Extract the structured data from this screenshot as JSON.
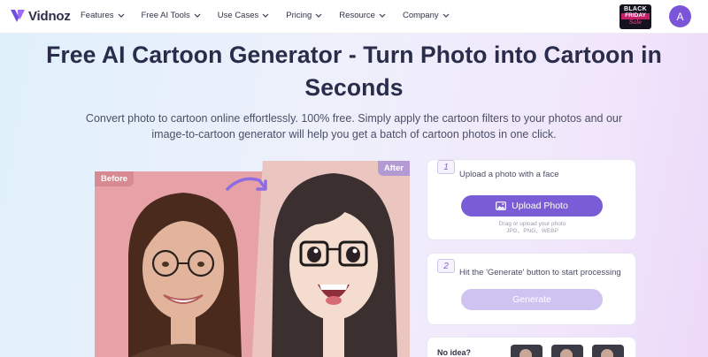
{
  "brand": {
    "name": "Vidnoz"
  },
  "nav": {
    "items": [
      {
        "label": "Features"
      },
      {
        "label": "Free AI Tools"
      },
      {
        "label": "Use Cases"
      },
      {
        "label": "Pricing"
      },
      {
        "label": "Resource"
      },
      {
        "label": "Company"
      }
    ],
    "promo": {
      "line1": "BLACK",
      "line2": "FRIDAY",
      "line3": "Sale"
    },
    "avatar_initial": "A"
  },
  "hero": {
    "title": "Free AI Cartoon Generator - Turn Photo into Cartoon in Seconds",
    "subtitle": "Convert photo to cartoon online effortlessly. 100% free. Simply apply the cartoon filters to your photos and our image-to-cartoon generator will help you get a batch of cartoon photos in one click."
  },
  "preview": {
    "before_label": "Before",
    "after_label": "After"
  },
  "steps": {
    "step1": {
      "number": "1",
      "text": "Upload a photo with a face",
      "button": "Upload Photo",
      "hint_line1": "Drag or upload your photo",
      "hint_line2": "JPG、PNG、WEBP"
    },
    "step2": {
      "number": "2",
      "text": "Hit the 'Generate' button to start processing",
      "button": "Generate"
    },
    "no_idea": "No idea?"
  },
  "colors": {
    "accent": "#7a5cd6",
    "accent_light": "#cfc3f2",
    "title": "#292c4a"
  },
  "icons": {
    "logo": "vidnoz-logo-icon",
    "chevron": "chevron-down-icon",
    "upload": "image-icon",
    "arrow": "curved-arrow-icon"
  }
}
